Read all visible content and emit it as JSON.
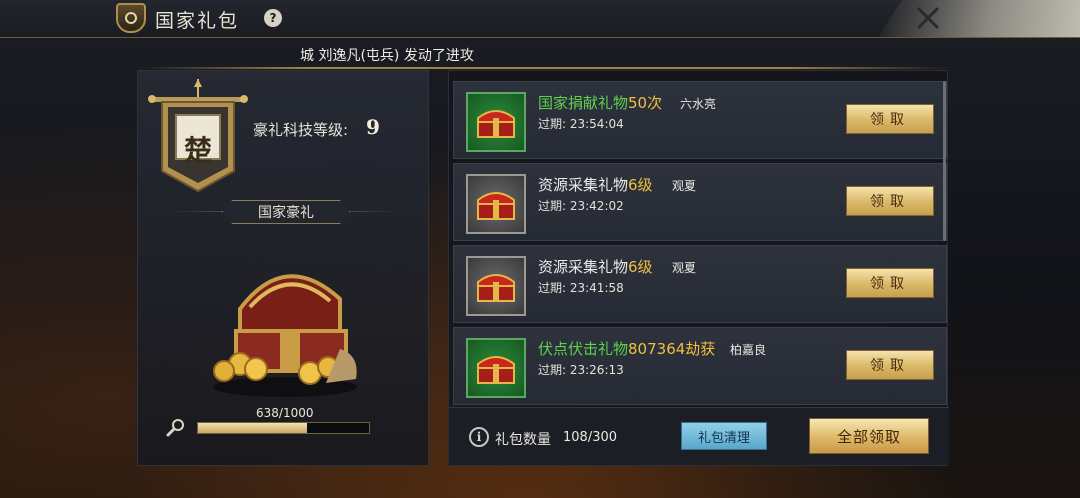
{
  "header": {
    "title": "国家礼包",
    "help_glyph": "?",
    "close_icon": "close-x-icon"
  },
  "notice": {
    "text": "城 刘逸凡(屯兵) 发动了进攻"
  },
  "left": {
    "banner_char": "楚",
    "tech_label": "豪礼科技等级:",
    "tech_level": "9",
    "section_title": "国家豪礼",
    "progress_text": "638/1000",
    "progress_fraction": 0.638
  },
  "gifts": [
    {
      "name": "国家捐献礼物",
      "highlight": "50次",
      "name_color": "green",
      "sender": "六水亮",
      "expire": "过期: 23:54:04",
      "chest_bg": "green",
      "claim_label": "领取"
    },
    {
      "name": "资源采集礼物",
      "highlight": "6级",
      "name_color": "white",
      "sender": "观夏",
      "expire": "过期: 23:42:02",
      "chest_bg": "gray",
      "claim_label": "领取"
    },
    {
      "name": "资源采集礼物",
      "highlight": "6级",
      "name_color": "white",
      "sender": "观夏",
      "expire": "过期: 23:41:58",
      "chest_bg": "gray",
      "claim_label": "领取"
    },
    {
      "name": "伏点伏击礼物",
      "highlight": "807364劫获",
      "name_color": "green",
      "sender": "柏嘉良",
      "expire": "过期: 23:26:13",
      "chest_bg": "green",
      "claim_label": "领取"
    }
  ],
  "footer": {
    "info_glyph": "i",
    "count_label": "礼包数量",
    "count_value": "108/300",
    "clear_label": "礼包清理",
    "claim_all_label": "全部领取"
  },
  "colors": {
    "accent_gold": "#d9b867",
    "green_name": "#5ed24c",
    "highlight_orange": "#f0c040",
    "clear_button": "#5aa7cc"
  }
}
